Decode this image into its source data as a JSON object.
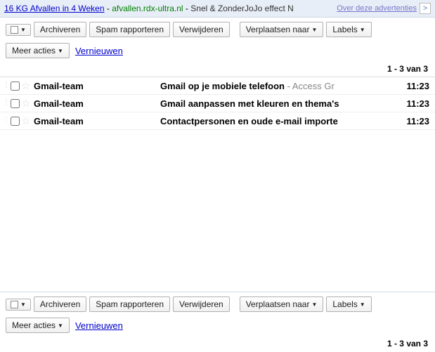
{
  "ad": {
    "link_text": "16 KG Afvallen in 4 Weken",
    "domain": "afvallen.rdx-ultra.nl",
    "text": "Snel & ZonderJoJo effect N",
    "about": "Over deze advertenties",
    "next": ">"
  },
  "toolbar": {
    "archive": "Archiveren",
    "report_spam": "Spam rapporteren",
    "delete": "Verwijderen",
    "move_to": "Verplaatsen naar",
    "labels": "Labels",
    "more_actions": "Meer acties",
    "refresh": "Vernieuwen",
    "dropdown_glyph": "▼"
  },
  "count_text": "1 - 3 van 3",
  "messages": [
    {
      "sender": "Gmail-team",
      "subject": "Gmail op je mobiele telefoon",
      "snippet": " - Access Gr",
      "time": "11:23"
    },
    {
      "sender": "Gmail-team",
      "subject": "Gmail aanpassen met kleuren en thema's",
      "snippet": "",
      "time": "11:23"
    },
    {
      "sender": "Gmail-team",
      "subject": "Contactpersonen en oude e-mail importe",
      "snippet": "",
      "time": "11:23"
    }
  ]
}
